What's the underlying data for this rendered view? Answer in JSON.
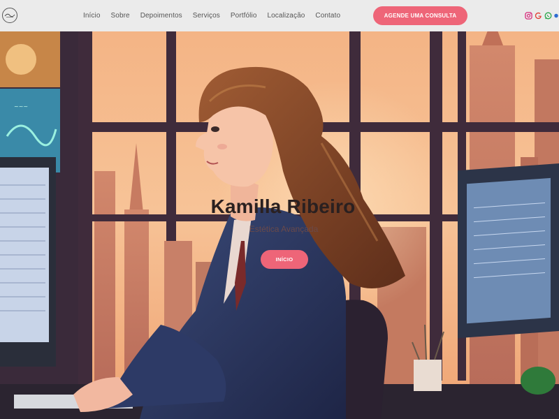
{
  "header": {
    "nav": [
      "Início",
      "Sobre",
      "Depoimentos",
      "Serviços",
      "Portfólio",
      "Localização",
      "Contato"
    ],
    "cta_label": "AGENDE UMA CONSULTA",
    "social_icons": [
      "instagram-icon",
      "google-icon",
      "whatsapp-icon",
      "facebook-icon"
    ]
  },
  "hero": {
    "title": "Kamilla Ribeiro",
    "subtitle": "Estética Avançada",
    "button_label": "INÍCIO"
  },
  "colors": {
    "accent": "#ee6578",
    "header_bg": "#ebebeb",
    "nav_text": "#555555"
  }
}
